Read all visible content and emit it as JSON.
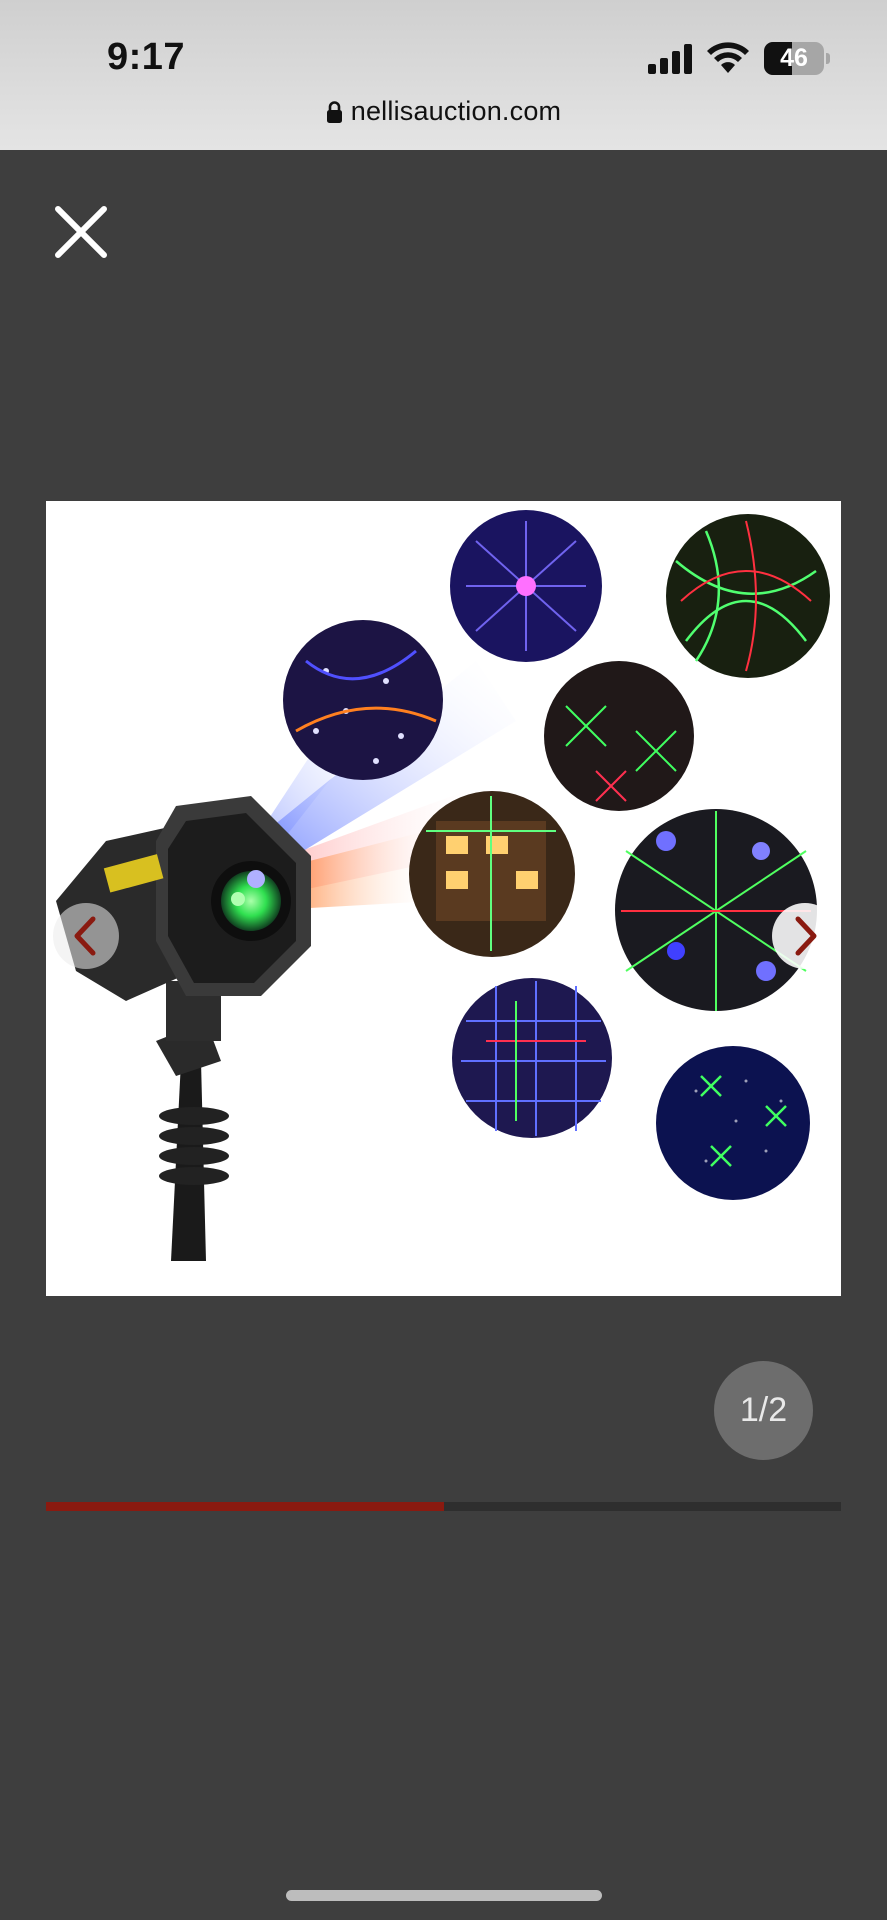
{
  "status_bar": {
    "time": "9:17",
    "battery_level": "46",
    "battery_fraction": 0.46,
    "signal_icon": "cellular-signal-icon",
    "wifi_icon": "wifi-icon"
  },
  "browser": {
    "url": "nellisauction.com",
    "lock_icon": "lock-icon"
  },
  "viewer": {
    "close_icon": "close-icon",
    "prev_icon": "chevron-left-icon",
    "next_icon": "chevron-right-icon",
    "page_counter": "1/2",
    "current_index": 1,
    "total_images": 2,
    "progress_fraction": 0.5,
    "colors": {
      "background": "#3e3e3e",
      "progress_fill": "#8a1a10",
      "progress_track": "#2e2e2e",
      "arrow_color": "#8a1a10"
    }
  }
}
